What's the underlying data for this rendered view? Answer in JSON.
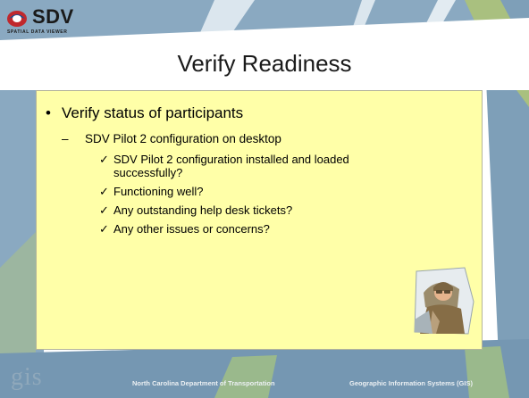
{
  "logo": {
    "brand": "SDV",
    "subtitle": "SPATIAL DATA VIEWER"
  },
  "slide": {
    "title": "Verify Readiness",
    "bullet_l1": "Verify status of participants",
    "bullet_l2": "SDV Pilot 2 configuration on desktop",
    "checks": [
      "SDV Pilot 2 configuration installed and loaded successfully?",
      "Functioning well?",
      "Any outstanding help desk tickets?",
      "Any other issues or concerns?"
    ],
    "bullet_symbol": "•",
    "dash_symbol": "–",
    "check_symbol": "✓"
  },
  "footer": {
    "gis_logo": "gis",
    "left": "North Carolina Department of Transportation",
    "right": "Geographic Information Systems (GIS)"
  },
  "colors": {
    "content_bg": "#ffffa8",
    "stripe_blue": "#7e9fb8",
    "stripe_green": "#a9c07f"
  }
}
